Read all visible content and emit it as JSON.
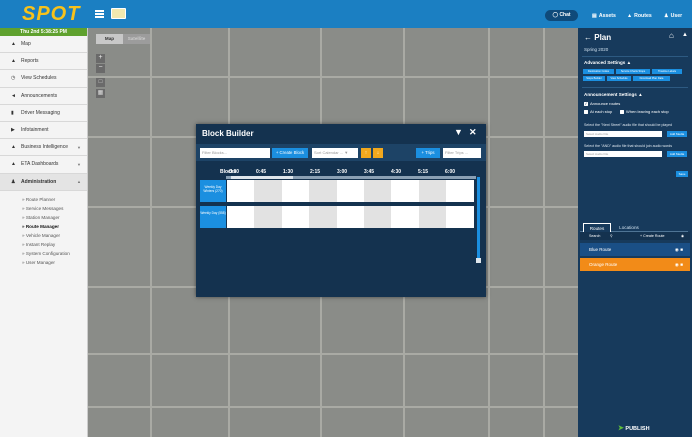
{
  "app": {
    "logo": "SPOT",
    "clock": "Thu 2nd 5:38:25 PM"
  },
  "header": {
    "chat": "Chat",
    "nav": [
      {
        "label": "Assets",
        "icon": "bus-icon"
      },
      {
        "label": "Routes",
        "icon": "road-icon"
      },
      {
        "label": "User",
        "icon": "user-icon"
      }
    ]
  },
  "sidebar": {
    "items": [
      {
        "label": "Map",
        "icon": "map-icon"
      },
      {
        "label": "Reports",
        "icon": "chart-icon"
      },
      {
        "label": "View Schedules",
        "icon": "clock-icon"
      },
      {
        "label": "Announcements",
        "icon": "megaphone-icon"
      },
      {
        "label": "Driver Messaging",
        "icon": "message-icon"
      },
      {
        "label": "Infotainment",
        "icon": "video-icon"
      },
      {
        "label": "Business Intelligence",
        "icon": "bi-chart-icon"
      },
      {
        "label": "ETA Dashboards",
        "icon": "dashboard-icon"
      },
      {
        "label": "Administration",
        "icon": "users-icon"
      }
    ],
    "admin_sub": [
      "» Route Planner",
      "» Service Messages",
      "» Station Manager",
      "» Route Manager",
      "» Vehicle Manager",
      "» Instant Replay",
      "» System Configuration",
      "» User Manager"
    ],
    "active_sub": "» Route Manager"
  },
  "map": {
    "tabs": [
      "Map",
      "Satellite"
    ],
    "active_tab": "Map"
  },
  "block_builder": {
    "title": "Block Builder",
    "filter_placeholder": "Filter Blocks...",
    "create_block": "+ Create Block",
    "calendar_select": "Sort Calendar ...",
    "trips_btn": "+ Trips",
    "trips_placeholder": "Filter Trips ...",
    "blocks_label": "Blocks",
    "times": [
      "0:00",
      "0:45",
      "1:30",
      "2:15",
      "3:00",
      "3:45",
      "4:30",
      "5:15",
      "6:00"
    ],
    "rows": [
      {
        "label": "Weekly Day Winters (270)"
      },
      {
        "label": "Weekly Day (558)"
      }
    ]
  },
  "plan": {
    "title": "Plan",
    "season": "Spring 2020",
    "advanced_title": "Advanced Settings",
    "chips": [
      "Destination Codes",
      "Service Charts Stops",
      "Timeline Labels",
      "Stops Builder",
      "View Schedule",
      "Download Plan Data"
    ],
    "announcement_title": "Announcement Settings",
    "announce_routes": "Announce routes",
    "at_each_stop": "At each stop",
    "when_leaving": "When leaving each stop",
    "next_street_label": "Select the \"Next Street\" audio file that should be played",
    "and_label": "Select the \"AND\" audio file that should join audio words",
    "audio_placeholder": "Select Audio File",
    "add_media": "Add Media",
    "save": "Save",
    "tabs": [
      "Routes",
      "Locations"
    ],
    "route_search": "Search",
    "create_route": "+ Create Route",
    "routes": [
      {
        "name": "Blue Route",
        "color": "#1a4f86"
      },
      {
        "name": "Orange Route",
        "color": "#f28b18"
      }
    ],
    "publish": "PUBLISH"
  },
  "colors": {
    "primary": "#1b7fc2",
    "panel": "#173a5c",
    "accent_blue": "#1b8fe0",
    "logo": "#f7c21b"
  }
}
